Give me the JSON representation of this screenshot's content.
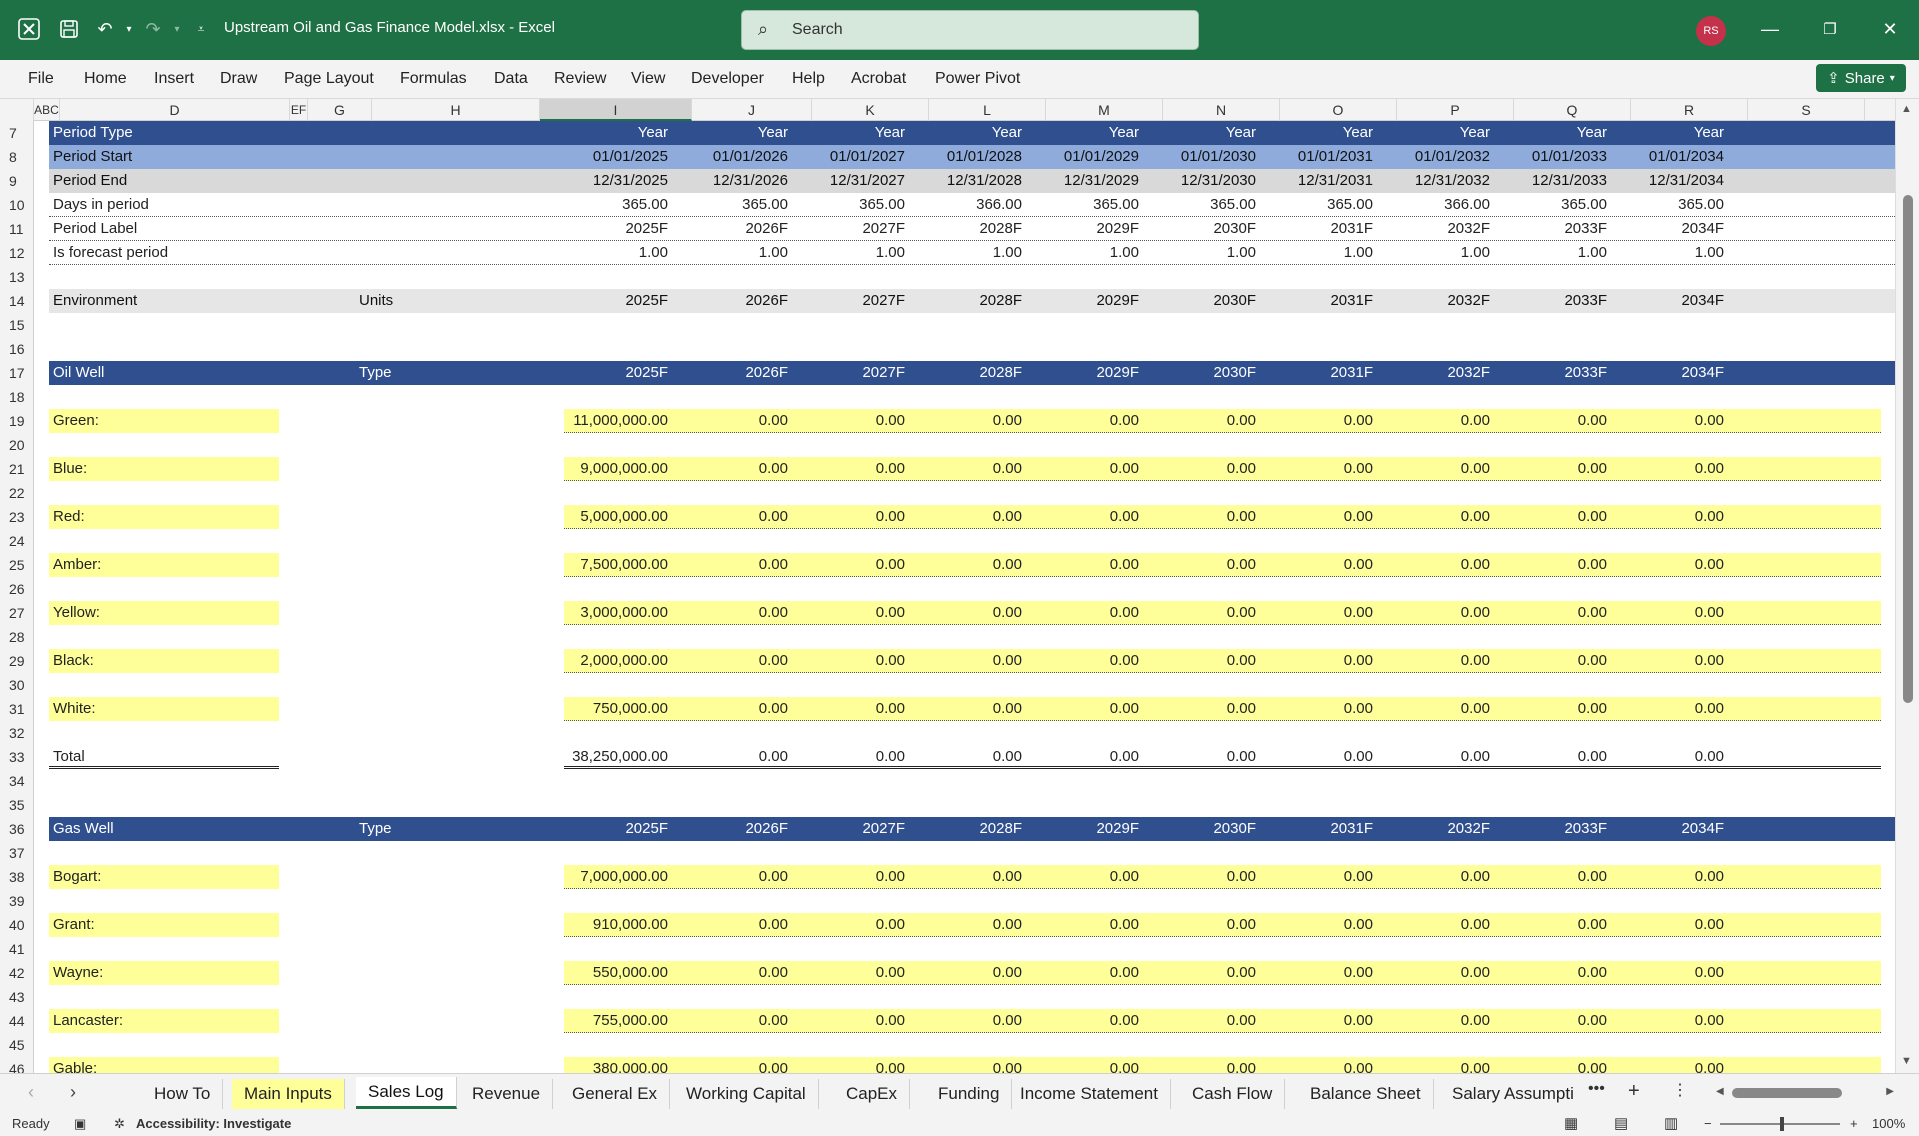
{
  "window": {
    "title": "Upstream Oil and Gas Finance Model.xlsx  -  Excel",
    "search_placeholder": "Search",
    "user_initials": "RS"
  },
  "ribbon": {
    "tabs": [
      "File",
      "Home",
      "Insert",
      "Draw",
      "Page Layout",
      "Formulas",
      "Data",
      "Review",
      "View",
      "Developer",
      "Help",
      "Acrobat",
      "Power Pivot"
    ],
    "share_label": "Share"
  },
  "columns": [
    "A",
    "B",
    "C",
    "D",
    "E",
    "F",
    "G",
    "H",
    "I",
    "J",
    "K",
    "L",
    "M",
    "N",
    "O",
    "P",
    "Q",
    "R",
    "S"
  ],
  "visible_column_labels": [
    "ABC",
    "D",
    "EF",
    "G",
    "H",
    "I",
    "J",
    "K",
    "L",
    "M",
    "N",
    "O",
    "P",
    "Q",
    "R",
    "S"
  ],
  "selected_column": "I",
  "years": [
    "2025F",
    "2026F",
    "2027F",
    "2028F",
    "2029F",
    "2030F",
    "2031F",
    "2032F",
    "2033F",
    "2034F"
  ],
  "sheet": {
    "period_type": {
      "label": "Period Type",
      "values": [
        "Year",
        "Year",
        "Year",
        "Year",
        "Year",
        "Year",
        "Year",
        "Year",
        "Year",
        "Year"
      ]
    },
    "period_start": {
      "label": "Period Start",
      "values": [
        "01/01/2025",
        "01/01/2026",
        "01/01/2027",
        "01/01/2028",
        "01/01/2029",
        "01/01/2030",
        "01/01/2031",
        "01/01/2032",
        "01/01/2033",
        "01/01/2034"
      ]
    },
    "period_end": {
      "label": "Period End",
      "values": [
        "12/31/2025",
        "12/31/2026",
        "12/31/2027",
        "12/31/2028",
        "12/31/2029",
        "12/31/2030",
        "12/31/2031",
        "12/31/2032",
        "12/31/2033",
        "12/31/2034"
      ]
    },
    "days_in_period": {
      "label": "Days in period",
      "values": [
        "365.00",
        "365.00",
        "365.00",
        "366.00",
        "365.00",
        "365.00",
        "365.00",
        "366.00",
        "365.00",
        "365.00"
      ]
    },
    "period_label": {
      "label": "Period Label",
      "values": [
        "2025F",
        "2026F",
        "2027F",
        "2028F",
        "2029F",
        "2030F",
        "2031F",
        "2032F",
        "2033F",
        "2034F"
      ]
    },
    "is_forecast": {
      "label": "Is forecast period",
      "values": [
        "1.00",
        "1.00",
        "1.00",
        "1.00",
        "1.00",
        "1.00",
        "1.00",
        "1.00",
        "1.00",
        "1.00"
      ]
    },
    "environment": {
      "label": "Environment",
      "units_label": "Units"
    },
    "oil_well": {
      "label": "Oil Well",
      "type_label": "Type",
      "items": [
        {
          "name": "Green:",
          "values": [
            "11,000,000.00",
            "0.00",
            "0.00",
            "0.00",
            "0.00",
            "0.00",
            "0.00",
            "0.00",
            "0.00",
            "0.00"
          ]
        },
        {
          "name": "Blue:",
          "values": [
            "9,000,000.00",
            "0.00",
            "0.00",
            "0.00",
            "0.00",
            "0.00",
            "0.00",
            "0.00",
            "0.00",
            "0.00"
          ]
        },
        {
          "name": "Red:",
          "values": [
            "5,000,000.00",
            "0.00",
            "0.00",
            "0.00",
            "0.00",
            "0.00",
            "0.00",
            "0.00",
            "0.00",
            "0.00"
          ]
        },
        {
          "name": "Amber:",
          "values": [
            "7,500,000.00",
            "0.00",
            "0.00",
            "0.00",
            "0.00",
            "0.00",
            "0.00",
            "0.00",
            "0.00",
            "0.00"
          ]
        },
        {
          "name": "Yellow:",
          "values": [
            "3,000,000.00",
            "0.00",
            "0.00",
            "0.00",
            "0.00",
            "0.00",
            "0.00",
            "0.00",
            "0.00",
            "0.00"
          ]
        },
        {
          "name": "Black:",
          "values": [
            "2,000,000.00",
            "0.00",
            "0.00",
            "0.00",
            "0.00",
            "0.00",
            "0.00",
            "0.00",
            "0.00",
            "0.00"
          ]
        },
        {
          "name": "White:",
          "values": [
            "750,000.00",
            "0.00",
            "0.00",
            "0.00",
            "0.00",
            "0.00",
            "0.00",
            "0.00",
            "0.00",
            "0.00"
          ]
        }
      ],
      "total": {
        "name": "Total",
        "values": [
          "38,250,000.00",
          "0.00",
          "0.00",
          "0.00",
          "0.00",
          "0.00",
          "0.00",
          "0.00",
          "0.00",
          "0.00"
        ]
      }
    },
    "gas_well": {
      "label": "Gas Well",
      "type_label": "Type",
      "items": [
        {
          "name": "Bogart:",
          "values": [
            "7,000,000.00",
            "0.00",
            "0.00",
            "0.00",
            "0.00",
            "0.00",
            "0.00",
            "0.00",
            "0.00",
            "0.00"
          ]
        },
        {
          "name": "Grant:",
          "values": [
            "910,000.00",
            "0.00",
            "0.00",
            "0.00",
            "0.00",
            "0.00",
            "0.00",
            "0.00",
            "0.00",
            "0.00"
          ]
        },
        {
          "name": "Wayne:",
          "values": [
            "550,000.00",
            "0.00",
            "0.00",
            "0.00",
            "0.00",
            "0.00",
            "0.00",
            "0.00",
            "0.00",
            "0.00"
          ]
        },
        {
          "name": "Lancaster:",
          "values": [
            "755,000.00",
            "0.00",
            "0.00",
            "0.00",
            "0.00",
            "0.00",
            "0.00",
            "0.00",
            "0.00",
            "0.00"
          ]
        },
        {
          "name": "Gable:",
          "values": [
            "380,000.00",
            "0.00",
            "0.00",
            "0.00",
            "0.00",
            "0.00",
            "0.00",
            "0.00",
            "0.00",
            "0.00"
          ]
        }
      ]
    }
  },
  "sheet_tabs": [
    {
      "label": "How To",
      "style": "plain"
    },
    {
      "label": "Main Inputs",
      "style": "yellow"
    },
    {
      "label": "Sales Log",
      "style": "active"
    },
    {
      "label": "Revenue",
      "style": "plain"
    },
    {
      "label": "General Ex",
      "style": "plain"
    },
    {
      "label": "Working Capital",
      "style": "plain"
    },
    {
      "label": "CapEx",
      "style": "plain"
    },
    {
      "label": "Funding",
      "style": "plain"
    },
    {
      "label": "Income Statement",
      "style": "plain"
    },
    {
      "label": "Cash Flow",
      "style": "plain"
    },
    {
      "label": "Balance Sheet",
      "style": "plain"
    },
    {
      "label": "Salary Assumpti",
      "style": "plain"
    }
  ],
  "status": {
    "ready": "Ready",
    "accessibility": "Accessibility: Investigate",
    "zoom": "100%"
  },
  "colors": {
    "excel_green": "#1e7145",
    "header_band": "#2f4f8f",
    "period_start_band": "#8fabdc",
    "grey_band": "#d9d9d9",
    "input_yellow": "#ffff99"
  }
}
